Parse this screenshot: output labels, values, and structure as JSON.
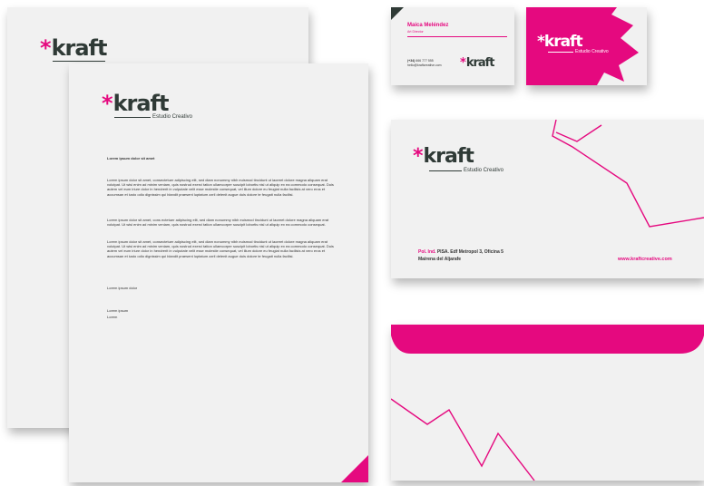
{
  "brand": {
    "name": "kraft",
    "star": "*",
    "tagline": "Estudio Creativo",
    "accent": "#e5097f",
    "dark": "#2f3a36"
  },
  "letter": {
    "subject": "Lorem ipsum dolor sit amet",
    "p1": "Lorem ipsum dolor sit amet, consectetuer adipiscing elit, sed diam nonummy nibh euismod tincidunt ut laoreet dolore magna aliquam erat volutpat. Ut wisi enim ad minim veniam, quis nostrud exerci tation ullamcorper suscipit lobortis nisl ut aliquip ex ea commodo consequat. Duis autem vel eum iriure dolor in hendrerit in vulputate velit esse molestie consequat, vel illum dolore eu feugiat nulla facilisis at vero eros et accumsan et iusto odio dignissim qui blandit praesent luptatum zzril delenit augue duis dolore te feugait nulla facilisi.",
    "p2": "Lorem ipsum dolor sit amet, cons ectetuer adipiscing elit, sed diam nonummy nibh euismod tincidunt ut laoreet dolore magna aliquam erat volutpat. Ut wisi enim ad minim veniam, quis nostrud exerci tation ullamcorper suscipit lobortis nisl ut aliquip ex ea commodo consequat.",
    "p3": "Lorem ipsum dolor sit amet, consectetuer adipiscing elit, sed diam nonummy nibh euismod tincidunt ut laoreet dolore magna aliquam erat volutpat. Ut wisi enim ad minim veniam, quis nostrud exerci tation ullamcorper suscipit lobortis nisl ut aliquip ex ea commodo consequat. Duis autem vel eum iriure dolor in hendrerit in vulputate velit esse molestie consequat, vel illum dolore eu feugiat nulla facilisis at vero eros et accumsan et iusto odio dignissim qui blandit praesent luptatum zzril delenit augue duis dolore te feugait nulla facilisi.",
    "closing": "Lorem ipsum dolor",
    "sign1": "Lorem ipsum",
    "sign2": "Lorem"
  },
  "card": {
    "name": "Maica Meléndez",
    "role": "Art Director",
    "phone_prefix": "(+34)",
    "phone": "666 777 555",
    "email": "hello@kraftcreative.com"
  },
  "envelope": {
    "address_prefix": "Pol. Ind.",
    "address_rest": " PISA. Edf Metropol 3, Oficina 5",
    "address_line2": "Mairena del Aljarafe",
    "website": "www.kraftcreative.com"
  }
}
